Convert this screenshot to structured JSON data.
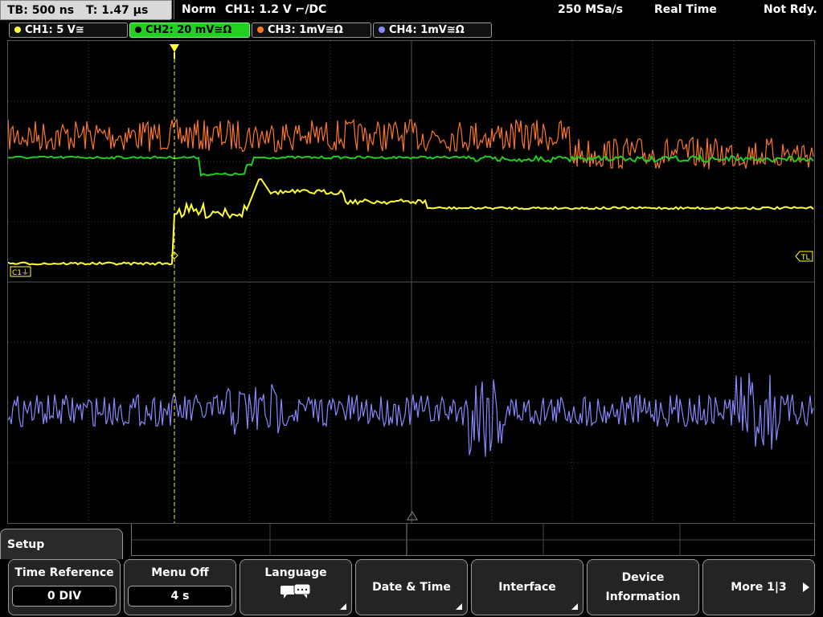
{
  "status_bar": {
    "timebase": "TB: 500 ns",
    "time": "T: 1.47 µs",
    "mode": "Norm",
    "trigger": "CH1: 1.2 V ⌐/DC",
    "sample_rate": "250 MSa/s",
    "acq_mode": "Real Time",
    "state": "Not Rdy."
  },
  "channels": [
    {
      "label": "CH1: 5 V≅",
      "color": "#ffff33"
    },
    {
      "label": "CH2: 20 mV≅Ω",
      "color": "#22cc22"
    },
    {
      "label": "CH3: 1mV≅Ω",
      "color": "#ff7722"
    },
    {
      "label": "CH4: 1mV≅Ω",
      "color": "#8888ff"
    }
  ],
  "markers": {
    "ch1_ground": "C1⏚",
    "trigger_level": "TL"
  },
  "menu": {
    "title": "Setup",
    "softkeys": [
      {
        "label": "Time Reference",
        "value": "0 DIV"
      },
      {
        "label": "Menu Off",
        "value": "4 s"
      },
      {
        "label": "Language",
        "icon": "speech-bubbles-icon"
      },
      {
        "label": "Date & Time"
      },
      {
        "label": "Interface"
      },
      {
        "label1": "Device",
        "label2": "Information"
      },
      {
        "label": "More 1|3"
      }
    ]
  },
  "colors": {
    "grid": "#3a3a3a",
    "trigger_line": "#ffff33"
  }
}
